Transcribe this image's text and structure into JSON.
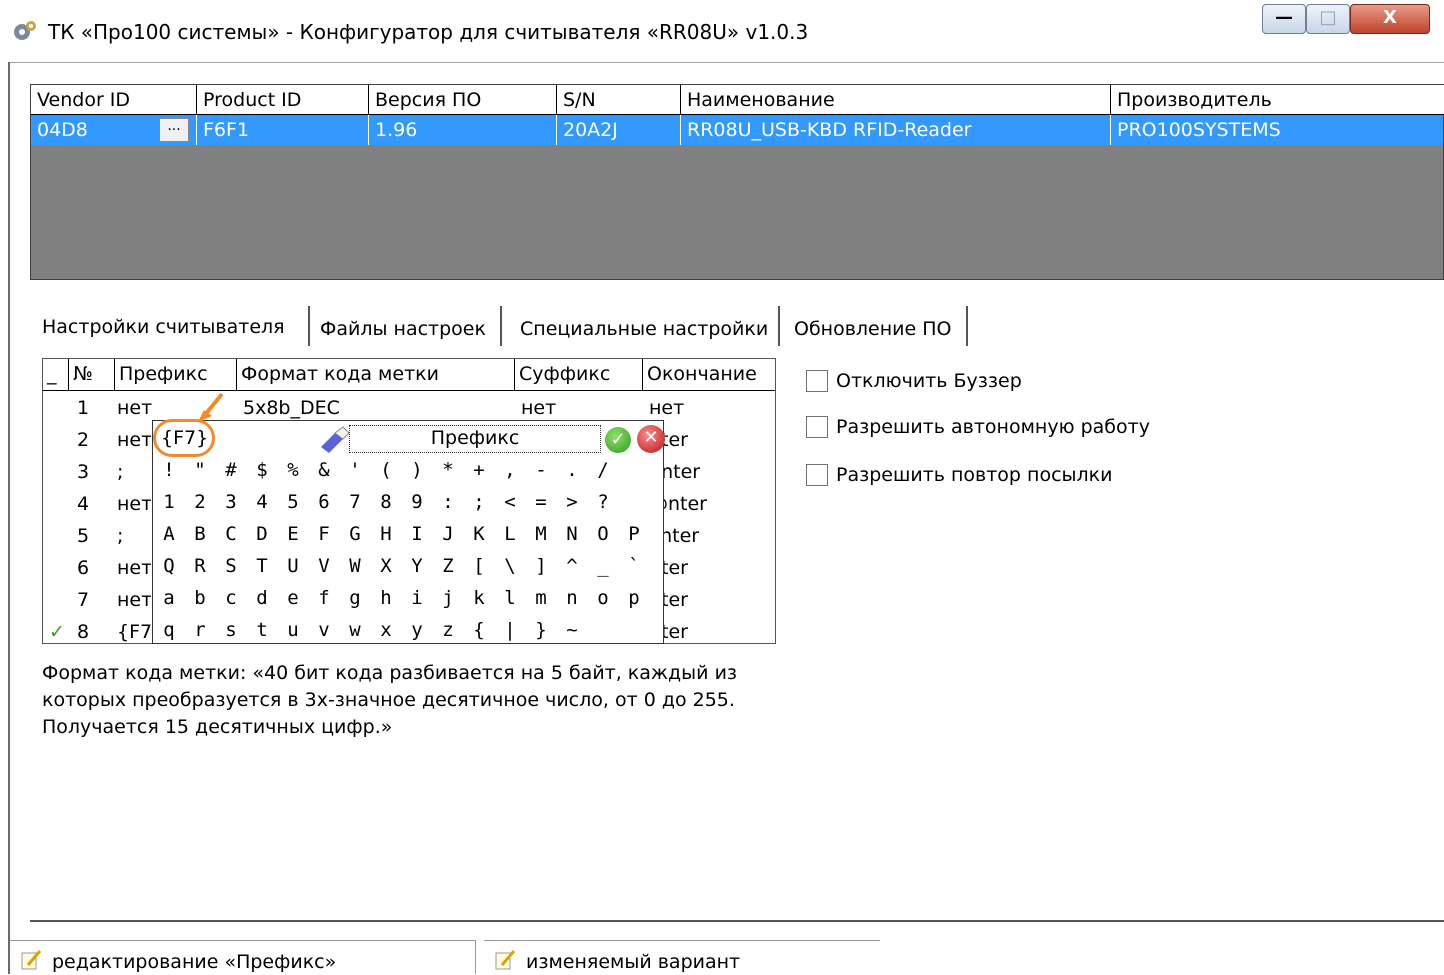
{
  "window": {
    "title": "ТК «Про100 системы» - Конфигуратор для считывателя «RR08U» v1.0.3",
    "minimize_glyph": "—",
    "maximize_glyph": "□",
    "close_glyph": "X"
  },
  "devices": {
    "columns": [
      "Vendor ID",
      "Product ID",
      "Версия ПО",
      "S/N",
      "Наименование",
      "Производитель"
    ],
    "rows": [
      [
        "04D8",
        "F6F1",
        "1.96",
        "20A2J",
        "RR08U_USB-KBD RFID-Reader",
        "PRO100SYSTEMS"
      ]
    ],
    "ellipsis": "..."
  },
  "tabs": [
    "Настройки считывателя",
    "Файлы настроек",
    "Специальные настройки",
    "Обновление ПО"
  ],
  "settings_table": {
    "columns": [
      "_",
      "№",
      "Префикс",
      "Формат кода метки",
      "Суффикс",
      "Окончание"
    ],
    "row1": {
      "num": "1",
      "prefix": "нет",
      "format": "5x8b_DEC",
      "suffix": "нет",
      "end": "нет"
    },
    "numbers": [
      "2",
      "3",
      "4",
      "5",
      "6",
      "7",
      "8"
    ],
    "prefixes": [
      "нет",
      ";",
      "нет",
      ";",
      "нет",
      "нет",
      "{F7"
    ],
    "end_tails": [
      "nter",
      "0nter",
      "@nter",
      "Pnter",
      "nter",
      "nter",
      "nter"
    ],
    "row8_check": "✓"
  },
  "prefix_popup": {
    "current_value": "{F7}",
    "label": "Префикс",
    "ok_glyph": "✓",
    "cancel_glyph": "✕",
    "char_rows": [
      [
        "!",
        "\"",
        "#",
        "$",
        "%",
        "&",
        "'",
        "(",
        ")",
        "*",
        "+",
        ",",
        "-",
        ".",
        "/"
      ],
      [
        "1",
        "2",
        "3",
        "4",
        "5",
        "6",
        "7",
        "8",
        "9",
        ":",
        ";",
        "<",
        "=",
        ">",
        "?"
      ],
      [
        "A",
        "B",
        "C",
        "D",
        "E",
        "F",
        "G",
        "H",
        "I",
        "J",
        "K",
        "L",
        "M",
        "N",
        "O",
        "P"
      ],
      [
        "Q",
        "R",
        "S",
        "T",
        "U",
        "V",
        "W",
        "X",
        "Y",
        "Z",
        "[",
        "\\",
        "]",
        "^",
        "_",
        "`"
      ],
      [
        "a",
        "b",
        "c",
        "d",
        "e",
        "f",
        "g",
        "h",
        "i",
        "j",
        "k",
        "l",
        "m",
        "n",
        "o",
        "p"
      ],
      [
        "q",
        "r",
        "s",
        "t",
        "u",
        "v",
        "w",
        "x",
        "y",
        "z",
        "{",
        "|",
        "}",
        "~"
      ]
    ]
  },
  "options": [
    {
      "label": "Отключить Буззер",
      "checked": false
    },
    {
      "label": "Разрешить автономную работу",
      "checked": false
    },
    {
      "label": "Разрешить повтор посылки",
      "checked": false
    }
  ],
  "description": "Формат кода метки: «40 бит кода разбивается на 5 байт, каждый из которых преобразуется в 3х-значное десятичное число, от 0 до 255. Получается 15 десятичных цифр.»",
  "statusbar": {
    "left": "редактирование «Префикс»",
    "right": "изменяемый вариант"
  },
  "colors": {
    "selection": "#3399ff",
    "highlight_circle": "#f08a2a",
    "grid_bg": "#808080"
  }
}
